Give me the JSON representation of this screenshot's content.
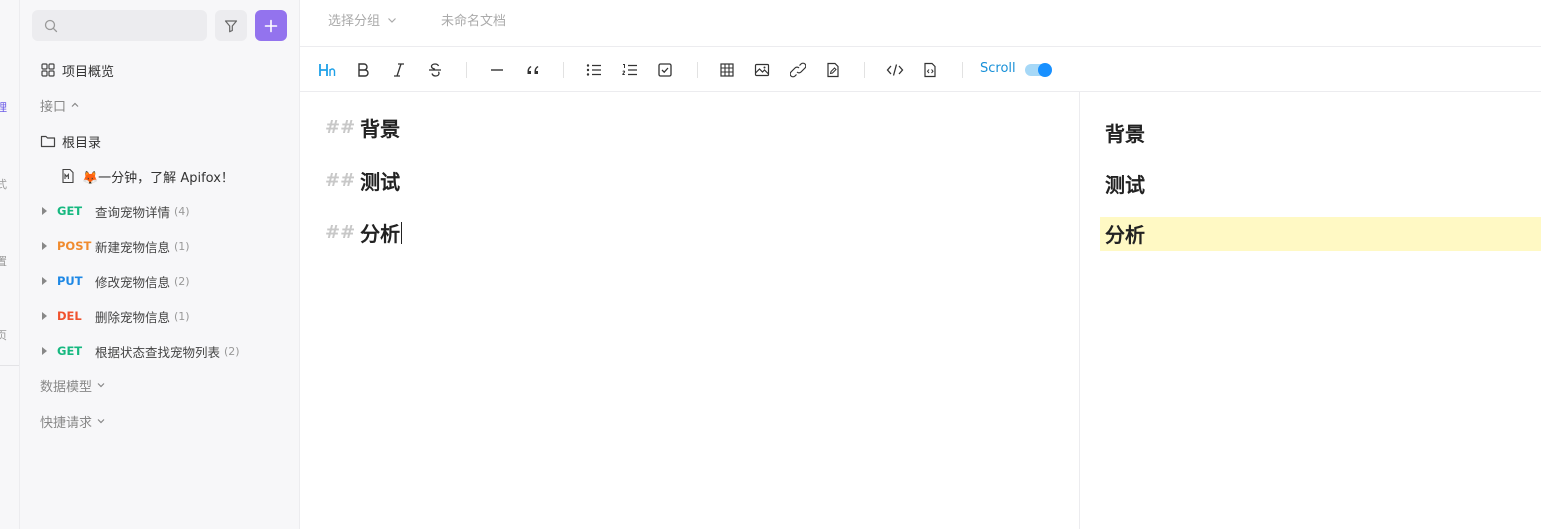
{
  "rail": {
    "glyphs": [
      "理",
      "式",
      "置",
      "页",
      "·"
    ]
  },
  "sidebar": {
    "search": {
      "placeholder": "",
      "value": ""
    },
    "overview_label": "项目概览",
    "interface_label": "接口",
    "root_folder": "根目录",
    "doc_item": "🦊一分钟，了解 Apifox！",
    "apis": [
      {
        "method": "GET",
        "color": "#16b880",
        "name": "查询宠物详情",
        "count": "(4)"
      },
      {
        "method": "POST",
        "color": "#f08b2e",
        "name": "新建宠物信息",
        "count": "(1)"
      },
      {
        "method": "PUT",
        "color": "#1e88e5",
        "name": "修改宠物信息",
        "count": "(2)"
      },
      {
        "method": "DEL",
        "color": "#f0522e",
        "name": "删除宠物信息",
        "count": "(1)"
      },
      {
        "method": "GET",
        "color": "#16b880",
        "name": "根据状态查找宠物列表",
        "count": "(2)"
      }
    ],
    "data_model_label": "数据模型",
    "quick_request_label": "快捷请求"
  },
  "topbar": {
    "group_select": "选择分组",
    "doc_title": "未命名文档"
  },
  "toolbar": {
    "scroll_label": "Scroll",
    "scroll_enabled": true
  },
  "editor": {
    "hash": "##",
    "lines": [
      "背景",
      "测试",
      "分析"
    ]
  },
  "preview": {
    "lines": [
      "背景",
      "测试",
      "分析"
    ]
  },
  "colors": {
    "accent": "#9373ee",
    "link": "#1890d8",
    "highlight": "#fff9c4"
  }
}
